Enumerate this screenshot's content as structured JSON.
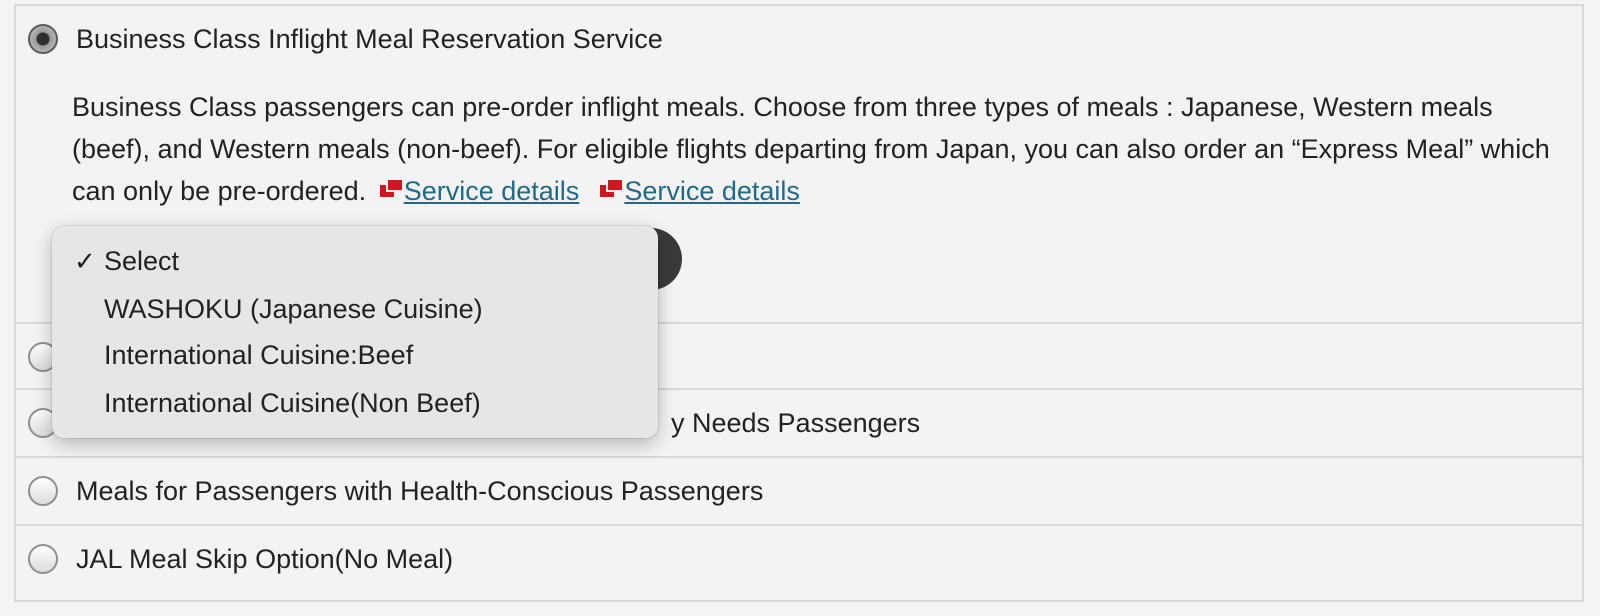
{
  "options": [
    {
      "label": "Business Class Inflight Meal Reservation Service",
      "checked": true
    },
    {
      "label": "",
      "checked": false
    },
    {
      "label": "y Needs Passengers",
      "checked": false
    },
    {
      "label": "Meals for Passengers with Health-Conscious Passengers",
      "checked": false
    },
    {
      "label": "JAL Meal Skip Option(No Meal)",
      "checked": false
    }
  ],
  "description": {
    "text": "Business Class passengers can pre-order inflight meals. Choose from three types of meals : Japanese, Western meals (beef), and Western meals (non-beef). For eligible flights departing from Japan, you can also order an “Express Meal” which can only be pre-ordered.",
    "link1": "Service details",
    "link2": "Service details",
    "link_icon": "external-link-icon"
  },
  "meal_select": {
    "selected": "Select",
    "options": [
      {
        "label": "Select",
        "checked": true
      },
      {
        "label": "WASHOKU (Japanese Cuisine)",
        "checked": false
      },
      {
        "label": "International Cuisine:Beef",
        "checked": false
      },
      {
        "label": "International Cuisine(Non Beef)",
        "checked": false
      }
    ]
  },
  "colors": {
    "link": "#1f6a8a",
    "icon_red": "#d0171f",
    "select_border": "#2b6f9a"
  }
}
